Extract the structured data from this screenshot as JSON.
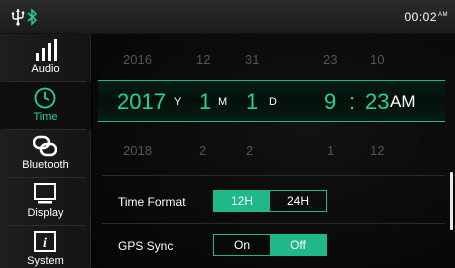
{
  "statusbar": {
    "clock": "00:02",
    "ampm": "AM"
  },
  "sidebar": {
    "items": [
      {
        "label": "Audio",
        "icon": "audio-levels-icon",
        "active": false
      },
      {
        "label": "Time",
        "icon": "clock-icon",
        "active": true
      },
      {
        "label": "Bluetooth",
        "icon": "bluetooth-link-icon",
        "active": false
      },
      {
        "label": "Display",
        "icon": "display-icon",
        "active": false
      },
      {
        "label": "System",
        "icon": "info-icon",
        "active": false
      }
    ]
  },
  "date_time": {
    "prev_row": {
      "year": "2016",
      "month": "12",
      "day": "31",
      "hour": "23",
      "minute": "10"
    },
    "selected_row": {
      "year": "2017",
      "year_unit": "Y",
      "month": "1",
      "month_unit": "M",
      "day": "1",
      "day_unit": "D",
      "hour": "9",
      "separator": ":",
      "minute": "23",
      "ampm": "AM"
    },
    "next_row": {
      "year": "2018",
      "month": "2",
      "day": "2",
      "hour": "1",
      "minute": "12"
    }
  },
  "settings": {
    "time_format": {
      "label": "Time Format",
      "options": [
        "12H",
        "24H"
      ],
      "selected": "12H"
    },
    "gps_sync": {
      "label": "GPS Sync",
      "options": [
        "On",
        "Off"
      ],
      "selected": "Off"
    }
  },
  "colors": {
    "accent": "#1fb888",
    "accent_text": "#1fd49a",
    "background": "#000000"
  }
}
